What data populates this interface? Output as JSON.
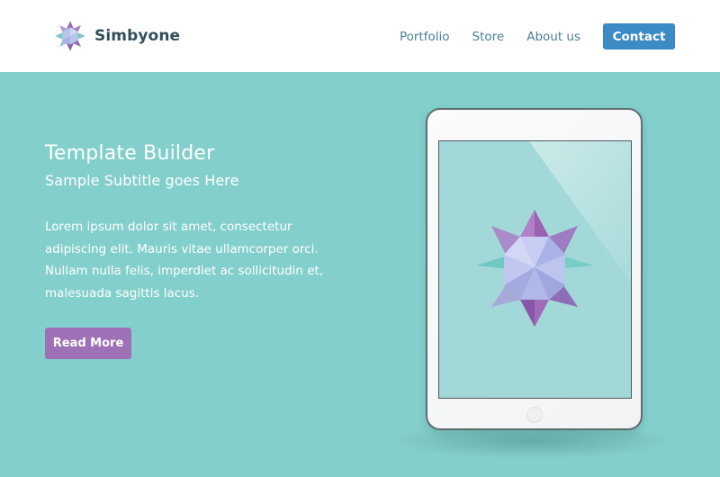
{
  "header": {
    "brand_name": "Simbyone",
    "logo_icon": "star-crystal-icon",
    "nav": [
      {
        "label": "Portfolio"
      },
      {
        "label": "Store"
      },
      {
        "label": "About us"
      }
    ],
    "contact_label": "Contact"
  },
  "hero": {
    "title": "Template Builder",
    "subtitle": "Sample Subtitle goes Here",
    "body": "Lorem ipsum dolor sit amet, consectetur adipiscing elit. Mauris vitae ullamcorper orci. Nullam nulla felis, imperdiet ac sollicitudin et, malesuada sagittis lacus.",
    "button_label": "Read More"
  },
  "colors": {
    "hero_background": "#83cfcb",
    "header_background": "#ffffff",
    "brand_text": "#2f4f5c",
    "nav_text": "#4a7f9c",
    "contact_button": "#3d8bc5",
    "read_more_button": "#9e70b5",
    "tablet_screen": "#a2d9d8"
  },
  "device": {
    "type": "tablet",
    "screen_icon": "star-crystal-icon"
  }
}
